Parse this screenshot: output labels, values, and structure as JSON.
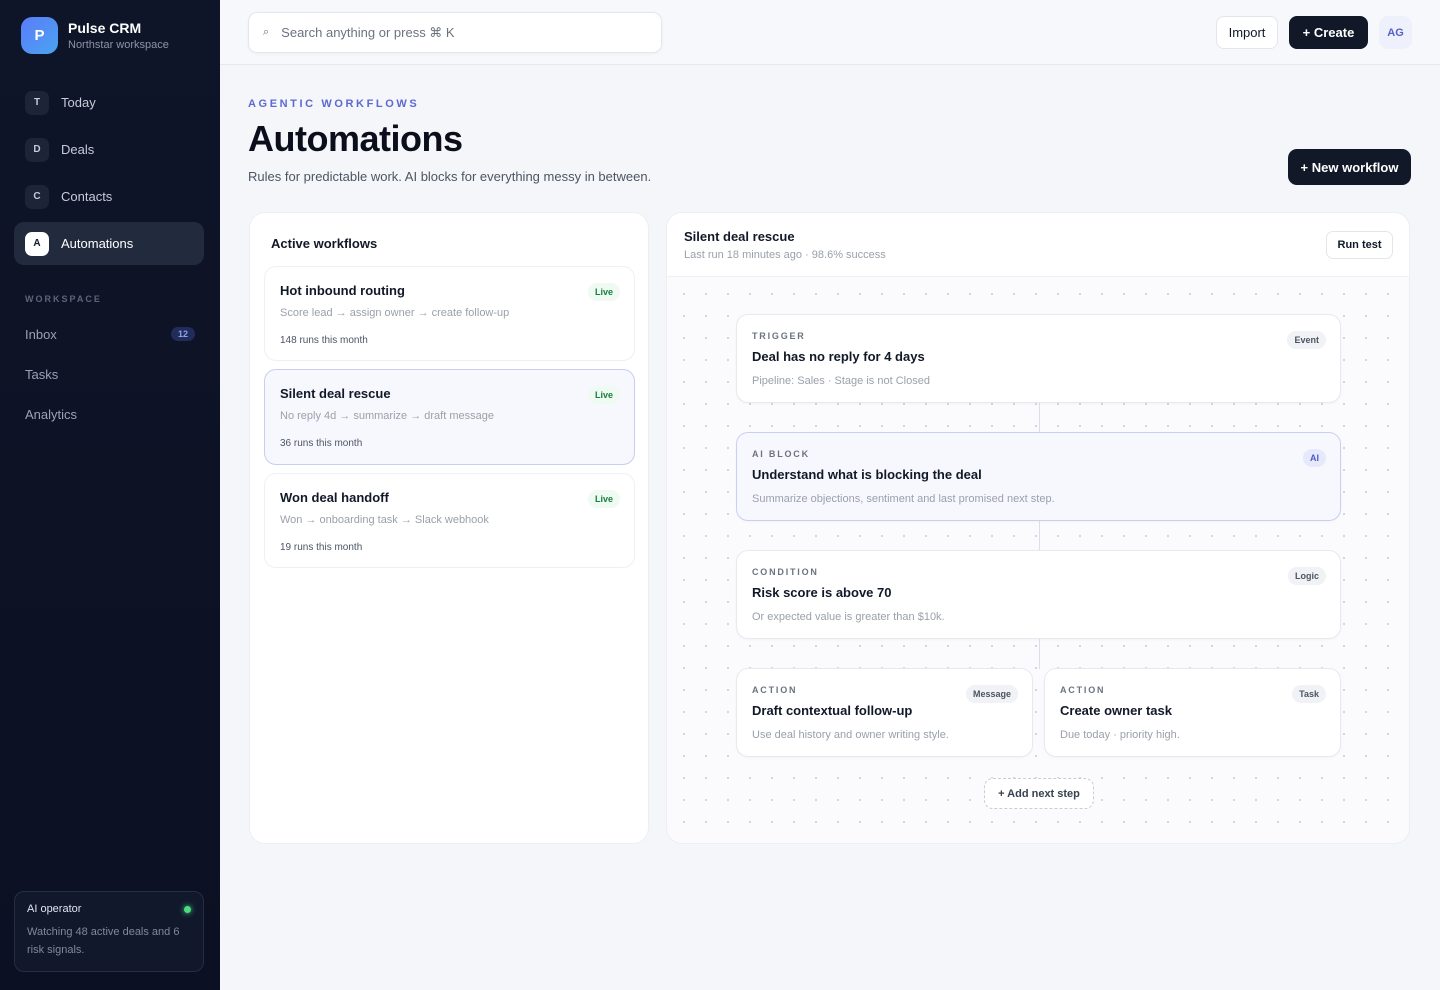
{
  "sidebar": {
    "brand": {
      "logo_letter": "P",
      "name": "Pulse CRM",
      "workspace": "Northstar workspace"
    },
    "nav": [
      {
        "badge": "T",
        "label": "Today",
        "active": false
      },
      {
        "badge": "D",
        "label": "Deals",
        "active": false
      },
      {
        "badge": "C",
        "label": "Contacts",
        "active": false
      },
      {
        "badge": "A",
        "label": "Automations",
        "active": true
      }
    ],
    "workspace_title": "WORKSPACE",
    "workspace_items": [
      {
        "label": "Inbox",
        "count": "12"
      },
      {
        "label": "Tasks"
      },
      {
        "label": "Analytics"
      }
    ],
    "operator": {
      "title": "AI operator",
      "text": "Watching 48 active deals and 6 risk signals."
    }
  },
  "topbar": {
    "search_placeholder": "Search anything or press ⌘ K",
    "import_label": "Import",
    "create_label": "+ Create",
    "avatar_initials": "AG"
  },
  "header": {
    "eyebrow": "AGENTIC WORKFLOWS",
    "title": "Automations",
    "subtitle": "Rules for predictable work. AI blocks for everything messy in between.",
    "new_workflow_label": "+ New workflow"
  },
  "workflows": {
    "title": "Active workflows",
    "items": [
      {
        "name": "Hot inbound routing",
        "status": "Live",
        "steps": "Score lead → assign owner → create follow-up",
        "runs": "148 runs this month"
      },
      {
        "name": "Silent deal rescue",
        "status": "Live",
        "steps": "No reply 4d → summarize → draft message",
        "runs": "36 runs this month"
      },
      {
        "name": "Won deal handoff",
        "status": "Live",
        "steps": "Won → onboarding task → Slack webhook",
        "runs": "19 runs this month"
      }
    ]
  },
  "builder": {
    "title": "Silent deal rescue",
    "meta": "Last run 18 minutes ago · 98.6% success",
    "run_test_label": "Run test",
    "trigger": {
      "kicker": "TRIGGER",
      "title": "Deal has no reply for 4 days",
      "desc": "Pipeline: Sales · Stage is not Closed",
      "tag": "Event"
    },
    "ai_block": {
      "kicker": "AI BLOCK",
      "title": "Understand what is blocking the deal",
      "desc": "Summarize objections, sentiment and last promised next step.",
      "tag": "AI"
    },
    "condition": {
      "kicker": "CONDITION",
      "title": "Risk score is above 70",
      "desc": "Or expected value is greater than $10k.",
      "tag": "Logic"
    },
    "action_1": {
      "kicker": "ACTION",
      "title": "Draft contextual follow-up",
      "desc": "Use deal history and owner writing style.",
      "tag": "Message"
    },
    "action_2": {
      "kicker": "ACTION",
      "title": "Create owner task",
      "desc": "Due today · priority high.",
      "tag": "Task"
    },
    "add_step_label": "+ Add next step"
  }
}
